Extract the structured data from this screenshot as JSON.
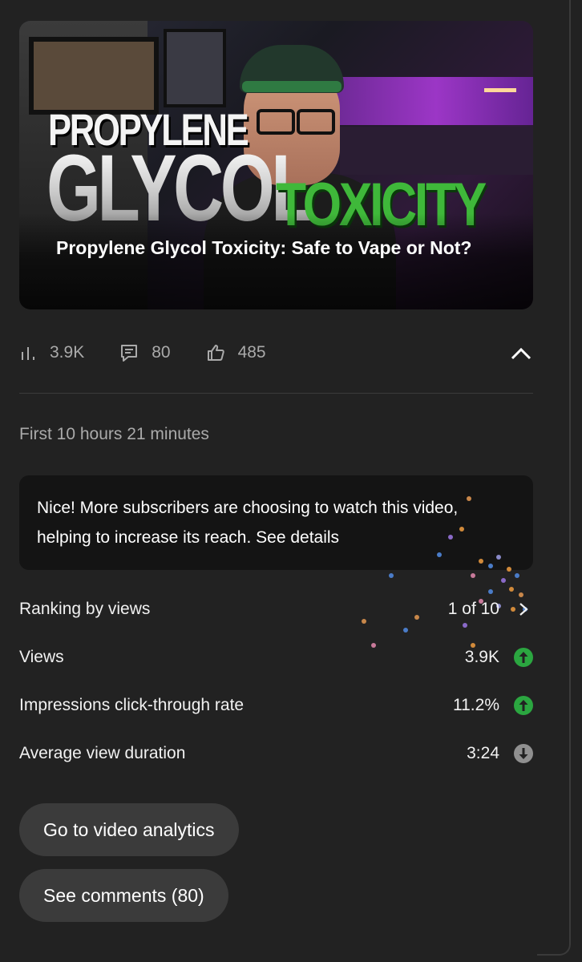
{
  "video": {
    "thumbnail_text": {
      "line1": "PROPYLENE",
      "line2": "GLYCOL",
      "line3": "TOXICITY"
    },
    "title": "Propylene Glycol Toxicity: Safe to Vape or Not?"
  },
  "stats": {
    "views": "3.9K",
    "comments": "80",
    "likes": "485"
  },
  "period": "First 10 hours 21 minutes",
  "insight": "Nice! More subscribers are choosing to watch this video, helping to increase its reach. See details",
  "metrics": [
    {
      "label": "Ranking by views",
      "value": "1 of 10",
      "indicator": "chevron-right"
    },
    {
      "label": "Views",
      "value": "3.9K",
      "indicator": "arrow-up",
      "color": "#2ba640"
    },
    {
      "label": "Impressions click-through rate",
      "value": "11.2%",
      "indicator": "arrow-up",
      "color": "#2ba640"
    },
    {
      "label": "Average view duration",
      "value": "3:24",
      "indicator": "arrow-down",
      "color": "#909090"
    }
  ],
  "buttons": {
    "analytics": "Go to video analytics",
    "comments": "See comments (80)"
  },
  "colors": {
    "background": "#222222",
    "positive": "#2ba640",
    "neutral": "#909090",
    "card": "#141414"
  }
}
